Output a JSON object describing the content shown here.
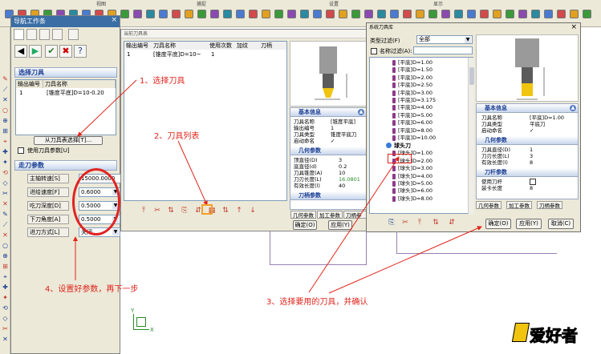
{
  "top_toolbar": {
    "group_labels": [
      "视图",
      "捕捉",
      "设置",
      "显示"
    ]
  },
  "navigator": {
    "title": "导航工作条",
    "close_glyph": "×",
    "section_tool": "选择刀具",
    "table_headers": [
      "输出编号",
      "刀具名称"
    ],
    "table_row": [
      "1",
      "[锥度平底]D=10-0.20"
    ],
    "select_from_library_button": "从刀具表选择[T]...",
    "use_tool_params_label": "使用刀具参数[U]",
    "section_params": "走刀参数",
    "params": [
      {
        "label": "主轴转速[S]",
        "value": "15000.0000"
      },
      {
        "label": "进给速度[F]",
        "value": "0.6000"
      },
      {
        "label": "吃刀深度[D]",
        "value": "0.5000"
      },
      {
        "label": "下刀角度[A]",
        "value": "0.5000"
      },
      {
        "label": "进刀方式[L]",
        "value": "关闭"
      }
    ]
  },
  "tool_table_dialog": {
    "title": "当前刀具表",
    "headers": [
      "输出编号",
      "刀具名称",
      "使用次数",
      "加纹",
      "刀柄"
    ],
    "row": [
      "1",
      "[锥度平底]D=10~",
      "1",
      "",
      ""
    ],
    "ok_button": "确定(O)",
    "apply_button": "应用(Y)",
    "props": {
      "basic_header": "基本信息",
      "basic": [
        {
          "key": "刀具名称",
          "value": "[锥度平底]"
        },
        {
          "key": "输出编号",
          "value": "1"
        },
        {
          "key": "刀具类型",
          "value": "锥度平底刀"
        },
        {
          "key": "启动命名",
          "value": "✓"
        }
      ],
      "geom_header": "几何参数",
      "geom": [
        {
          "key": "顶直径(D)",
          "value": "3"
        },
        {
          "key": "底直径(d)",
          "value": "0.2"
        },
        {
          "key": "刀具锥度(A)",
          "value": "10"
        },
        {
          "key": "刀刃长度(L)",
          "value": "16.0801"
        },
        {
          "key": "有效长度(l)",
          "value": "40"
        }
      ],
      "shank_header": "刀柄参数",
      "tabs": [
        "几何参数",
        "加工参数",
        "刀柄参数"
      ]
    }
  },
  "lib_dialog": {
    "title": "系统刀具库",
    "type_filter_label": "类型过滤(F)",
    "type_filter_value": "全部",
    "name_filter_label": "名称过滤(A):",
    "tree_items_flat": [
      "[平底]D=1.00",
      "[平底]D=1.50",
      "[平底]D=2.00",
      "[平底]D=2.50",
      "[平底]D=3.00",
      "[平底]D=3.175",
      "[平底]D=4.00",
      "[平底]D=5.00",
      "[平底]D=6.00",
      "[平底]D=8.00",
      "[平底]D=10.00"
    ],
    "tree_group_ball": "球头刀",
    "tree_items_ball": [
      "[球头]D=1.00",
      "[球头]D=2.00",
      "[球头]D=3.00",
      "[球头]D=4.00",
      "[球头]D=5.00",
      "[球头]D=6.00",
      "[球头]D=8.00"
    ],
    "props": {
      "basic_header": "基本信息",
      "basic": [
        {
          "key": "刀具名称",
          "value": "[平底]D=1.00"
        },
        {
          "key": "刀具类型",
          "value": "平底刀"
        },
        {
          "key": "启动命名",
          "value": "✓"
        }
      ],
      "geom_header": "几何参数",
      "geom": [
        {
          "key": "刀具直径(D)",
          "value": "1"
        },
        {
          "key": "刀刃长度(L)",
          "value": "3"
        },
        {
          "key": "有效长度(l)",
          "value": "8"
        }
      ],
      "shank_header": "刀杆参数",
      "shank": [
        {
          "key": "使用刀杆",
          "value": ""
        },
        {
          "key": "装卡长度",
          "value": "8"
        }
      ],
      "tabs": [
        "几何参数",
        "加工参数",
        "刀柄参数"
      ]
    },
    "ok_button": "确定(O)",
    "apply_button": "应用(Y)",
    "cancel_button": "取消(C)"
  },
  "annotations": {
    "step1": "1、选择刀具",
    "step2": "2、刀具列表",
    "step3": "3、选择要用的刀具，并确认",
    "step4": "4、设置好参数，再下一步"
  },
  "axes": {
    "y": "Y",
    "x": "X"
  },
  "watermark": "爱好者",
  "colors": {
    "annotation_red": "#e0241b",
    "header_blue": "#1c3f94",
    "title_bar": "#3a6ea5"
  }
}
